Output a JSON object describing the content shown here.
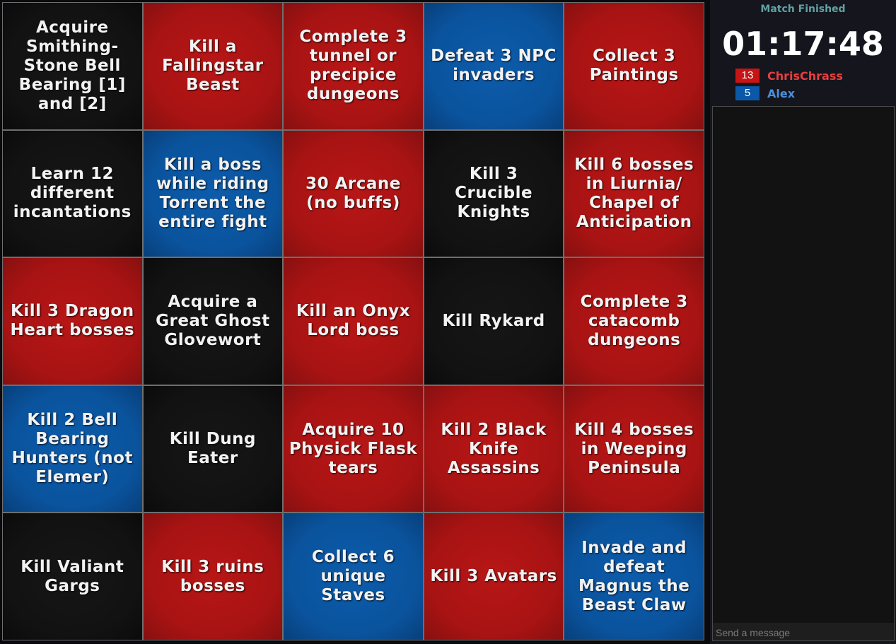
{
  "colors": {
    "red": "#b81616",
    "blue": "#0a539d",
    "black": "#121212",
    "status_text": "#5fa3a3",
    "player1_name": "#e44040",
    "player2_name": "#4a8fdc"
  },
  "board": {
    "cells": [
      {
        "text": "Acquire Smithing-Stone Bell Bearing [1] and [2]",
        "color": "black"
      },
      {
        "text": "Kill a Fallingstar Beast",
        "color": "red"
      },
      {
        "text": "Complete 3 tunnel or precipice dungeons",
        "color": "red"
      },
      {
        "text": "Defeat 3 NPC invaders",
        "color": "blue"
      },
      {
        "text": "Collect 3 Paintings",
        "color": "red"
      },
      {
        "text": "Learn 12 different incantations",
        "color": "black"
      },
      {
        "text": "Kill a boss while riding Torrent the entire fight",
        "color": "blue"
      },
      {
        "text": "30 Arcane (no buffs)",
        "color": "red"
      },
      {
        "text": "Kill 3 Crucible Knights",
        "color": "black"
      },
      {
        "text": "Kill 6 bosses in Liurnia/ Chapel of Anticipation",
        "color": "red"
      },
      {
        "text": "Kill 3 Dragon Heart bosses",
        "color": "red"
      },
      {
        "text": "Acquire a Great Ghost Glovewort",
        "color": "black"
      },
      {
        "text": "Kill an Onyx Lord boss",
        "color": "red"
      },
      {
        "text": "Kill Rykard",
        "color": "black"
      },
      {
        "text": "Complete 3 catacomb dungeons",
        "color": "red"
      },
      {
        "text": "Kill 2 Bell Bearing Hunters (not Elemer)",
        "color": "blue"
      },
      {
        "text": "Kill Dung Eater",
        "color": "black"
      },
      {
        "text": "Acquire 10 Physick Flask tears",
        "color": "red"
      },
      {
        "text": "Kill 2 Black Knife Assassins",
        "color": "red"
      },
      {
        "text": "Kill 4 bosses in Weeping Peninsula",
        "color": "red"
      },
      {
        "text": "Kill Valiant Gargs",
        "color": "black"
      },
      {
        "text": "Kill 3 ruins bosses",
        "color": "red"
      },
      {
        "text": "Collect 6 unique Staves",
        "color": "blue"
      },
      {
        "text": "Kill 3 Avatars",
        "color": "red"
      },
      {
        "text": "Invade and defeat Magnus the Beast Claw",
        "color": "blue"
      }
    ]
  },
  "sidebar": {
    "status": "Match Finished",
    "timer": "01:17:48",
    "players": [
      {
        "score": "13",
        "name": "ChrisChrass",
        "color": "red"
      },
      {
        "score": "5",
        "name": "Alex",
        "color": "blue"
      }
    ],
    "chat": {
      "placeholder": "Send a message"
    }
  }
}
